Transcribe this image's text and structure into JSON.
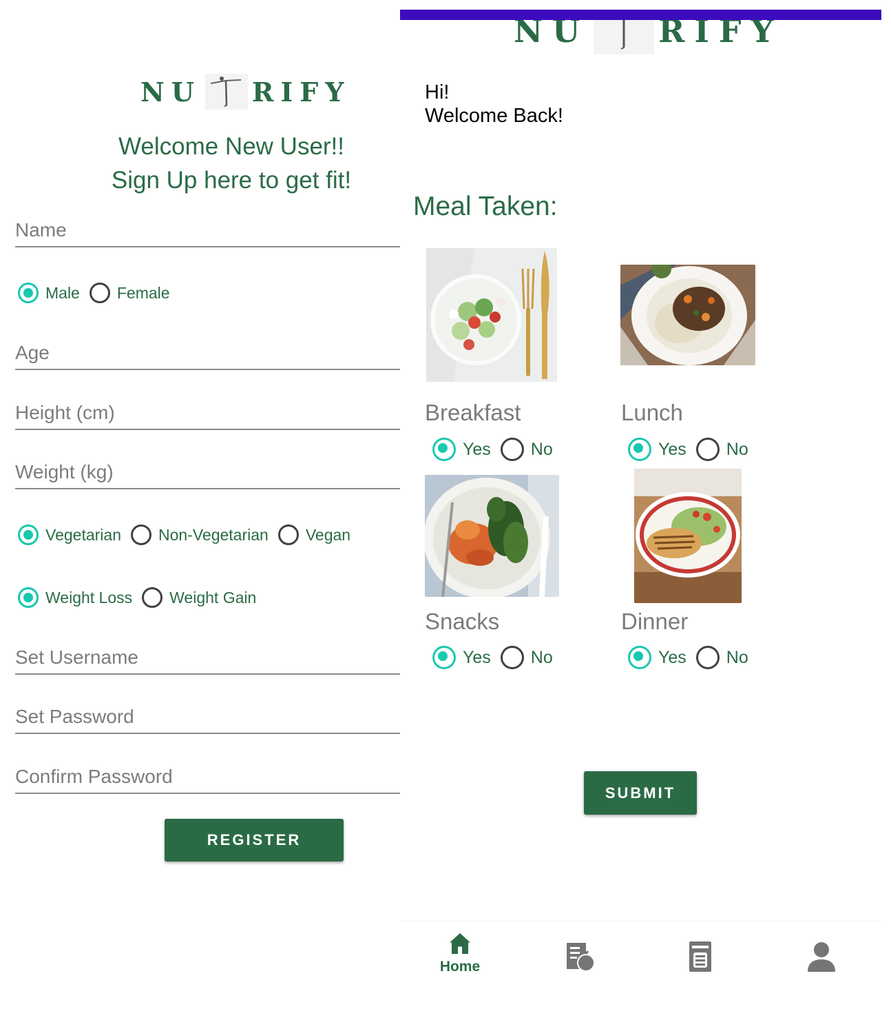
{
  "colors": {
    "brand_green": "#2a6b46",
    "radio_accent": "#17c9ae",
    "top_bar": "#3c0bbe",
    "hint_gray": "#7c7c7c"
  },
  "signup": {
    "logo_left": "NU",
    "logo_right": "RIFY",
    "welcome_line1": "Welcome New User!!",
    "welcome_line2": "Sign Up here to get fit!",
    "fields": {
      "name": "Name",
      "age": "Age",
      "height": "Height (cm)",
      "weight": "Weight (kg)",
      "username": "Set Username",
      "password": "Set Password",
      "confirm": "Confirm Password"
    },
    "gender": {
      "options": [
        "Male",
        "Female"
      ],
      "selected": "Male"
    },
    "diet": {
      "options": [
        "Vegetarian",
        "Non-Vegetarian",
        "Vegan"
      ],
      "selected": "Vegetarian"
    },
    "goal": {
      "options": [
        "Weight Loss",
        "Weight Gain"
      ],
      "selected": "Weight Loss"
    },
    "register_label": "REGISTER"
  },
  "home": {
    "logo_left": "NU",
    "logo_right": "RIFY",
    "greeting_line1": "Hi!",
    "greeting_line2": "Welcome Back!",
    "meal_title": "Meal Taken:",
    "yes_label": "Yes",
    "no_label": "No",
    "meals": [
      {
        "name": "Breakfast",
        "image": "salad-bowl-photo",
        "selected": "Yes"
      },
      {
        "name": "Lunch",
        "image": "rice-bowl-photo",
        "selected": "Yes"
      },
      {
        "name": "Snacks",
        "image": "salmon-greens-photo",
        "selected": "Yes"
      },
      {
        "name": "Dinner",
        "image": "chicken-zoodles-photo",
        "selected": "Yes"
      }
    ],
    "submit_label": "SUBMIT",
    "nav": [
      {
        "label": "Home",
        "icon": "home-icon",
        "active": true
      },
      {
        "label": "",
        "icon": "diet-plan-icon",
        "active": false
      },
      {
        "label": "",
        "icon": "report-icon",
        "active": false
      },
      {
        "label": "",
        "icon": "profile-icon",
        "active": false
      }
    ]
  }
}
